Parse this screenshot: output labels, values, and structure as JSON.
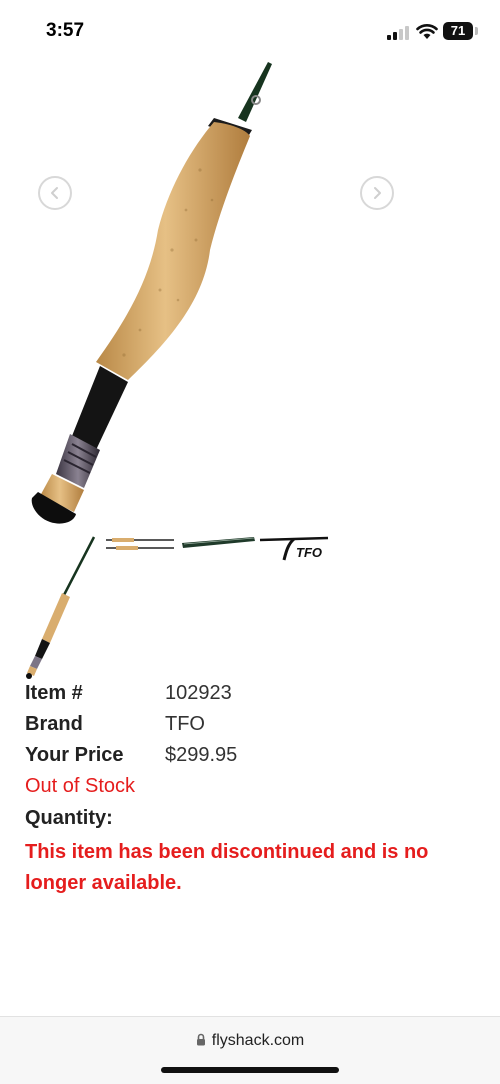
{
  "status_bar": {
    "time": "3:57",
    "battery": "71"
  },
  "product": {
    "details": [
      {
        "label": "Item #",
        "value": "102923"
      },
      {
        "label": "Brand",
        "value": "TFO"
      },
      {
        "label": "Your Price",
        "value": "$299.95"
      }
    ],
    "stock_status": "Out of Stock",
    "quantity_label": "Quantity:",
    "discontinued_message": "This item has been discontinued and is no longer available.",
    "thumbnail_logo_text": "TFO"
  },
  "browser": {
    "url": "flyshack.com"
  },
  "colors": {
    "alert_red": "#e51d1d",
    "cork": "#d9ad6e",
    "blank_green": "#17341f"
  },
  "icons": [
    "chevron-left-icon",
    "chevron-right-icon",
    "lock-icon",
    "wifi-icon",
    "signal-icon"
  ]
}
